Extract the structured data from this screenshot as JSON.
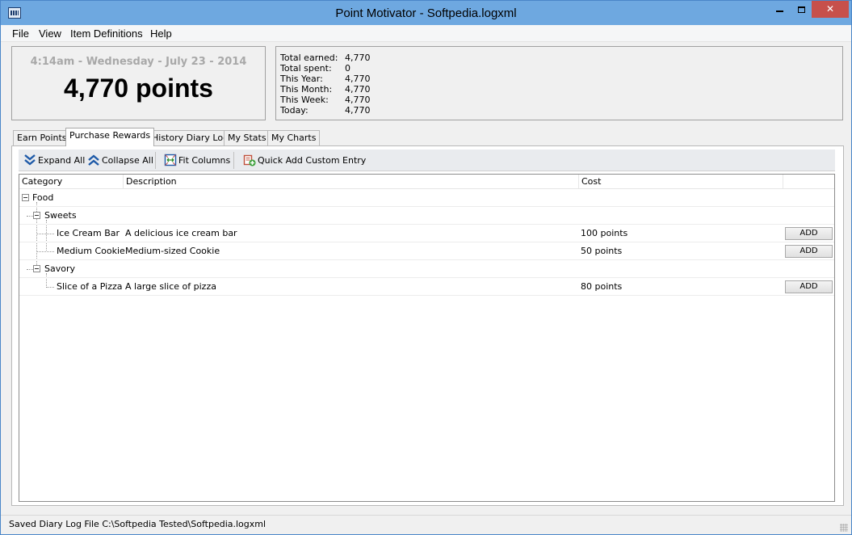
{
  "window": {
    "title": "Point Motivator - Softpedia.logxml",
    "minimize_icon": "minimize-icon",
    "maximize_icon": "maximize-icon",
    "close_label": "✕"
  },
  "menu": {
    "items": [
      "File",
      "View",
      "Item Definitions",
      "Help"
    ]
  },
  "clock": {
    "datetime": "4:14am - Wednesday - July 23 - 2014",
    "points": "4,770 points"
  },
  "stats": {
    "rows": [
      {
        "label": "Total earned:",
        "value": "4,770"
      },
      {
        "label": "Total spent:",
        "value": "0"
      },
      {
        "label": "This Year:",
        "value": "4,770"
      },
      {
        "label": "This Month:",
        "value": "4,770"
      },
      {
        "label": "This Week:",
        "value": "4,770"
      },
      {
        "label": "Today:",
        "value": "4,770"
      }
    ]
  },
  "tabs": [
    {
      "label": "Earn Points",
      "active": false
    },
    {
      "label": "Purchase Rewards",
      "active": true
    },
    {
      "label": "History Diary Log",
      "active": false
    },
    {
      "label": "My Stats",
      "active": false
    },
    {
      "label": "My Charts",
      "active": false
    }
  ],
  "toolbar": {
    "expand_all": "Expand All",
    "collapse_all": "Collapse All",
    "fit_columns": "Fit Columns",
    "quick_add": "Quick Add Custom Entry"
  },
  "grid": {
    "columns": [
      "Category",
      "Description",
      "Cost",
      ""
    ],
    "groups": [
      {
        "label": "Food",
        "level": 0
      },
      {
        "label": "Sweets",
        "level": 1
      },
      {
        "label": "Savory",
        "level": 1
      }
    ],
    "items": [
      {
        "name": "Ice Cream Bar",
        "description": "A delicious ice cream bar",
        "cost": "100 points",
        "action": "ADD"
      },
      {
        "name": "Medium Cookie",
        "description": "Medium-sized Cookie",
        "cost": "50 points",
        "action": "ADD"
      },
      {
        "name": "Slice of a Pizza",
        "description": "A large slice of pizza",
        "cost": "80 points",
        "action": "ADD"
      }
    ]
  },
  "status": {
    "text": "Saved Diary Log File C:\\Softpedia Tested\\Softpedia.logxml"
  },
  "colors": {
    "titlebar": "#6ea8e0",
    "close_button": "#c7504b",
    "panel_bg": "#f0f0f0"
  }
}
